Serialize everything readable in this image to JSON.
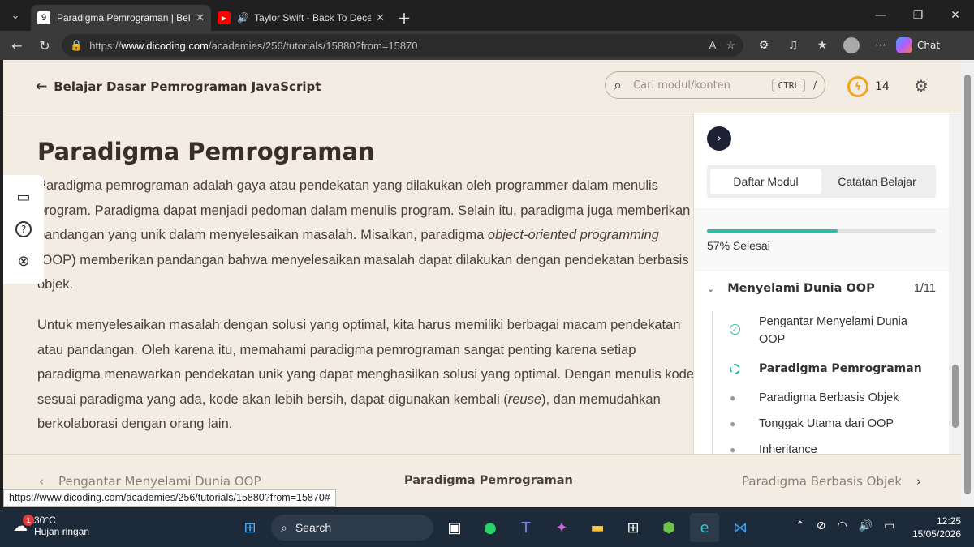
{
  "browser": {
    "tabs": [
      {
        "favicon": "9",
        "title": "Paradigma Pemrograman | Belajar",
        "active": true
      },
      {
        "favicon": "▶",
        "title": "Taylor Swift - Back To Decemb",
        "active": false
      }
    ],
    "url_prefix": "https://",
    "url_host": "www.dicoding.com",
    "url_path": "/academies/256/tutorials/15880?from=15870",
    "chat_label": "Chat"
  },
  "header": {
    "back_label": "Belajar Dasar Pemrograman JavaScript",
    "search_placeholder": "Cari modul/konten",
    "kbd_ctrl": "CTRL",
    "kbd_slash": "/",
    "points": "14"
  },
  "article": {
    "title": "Paradigma Pemrograman",
    "p1_a": "Paradigma pemrograman adalah gaya atau pendekatan yang dilakukan oleh programmer dalam menulis program. Paradigma dapat menjadi pedoman dalam menulis program. Selain itu, paradigma juga memberikan pandangan yang unik dalam menyelesaikan masalah. Misalkan, paradigma ",
    "p1_em": "object-oriented programming",
    "p1_b": " (OOP) memberikan pandangan bahwa menyelesaikan masalah dapat dilakukan dengan pendekatan berbasis objek.",
    "p2_a": "Untuk menyelesaikan masalah dengan solusi yang optimal, kita harus memiliki berbagai macam pendekatan atau pandangan. Oleh karena itu, memahami paradigma pemrograman sangat penting karena setiap paradigma menawarkan pendekatan unik yang dapat menghasilkan solusi yang optimal. Dengan menulis kode sesuai paradigma yang ada, kode akan lebih bersih, dapat digunakan kembali (",
    "p2_em": "reuse",
    "p2_b": "), dan memudahkan berkolaborasi dengan orang lain."
  },
  "sidebar": {
    "tabs": [
      "Daftar Modul",
      "Catatan Belajar"
    ],
    "progress_pct": 57,
    "progress_label": "57% Selesai",
    "module_title": "Menyelami Dunia OOP",
    "module_count": "1/11",
    "items": [
      {
        "label": "Pengantar Menyelami Dunia OOP",
        "state": "done"
      },
      {
        "label": "Paradigma Pemrograman",
        "state": "current"
      },
      {
        "label": "Paradigma Berbasis Objek",
        "state": "todo"
      },
      {
        "label": "Tonggak Utama dari OOP",
        "state": "todo"
      },
      {
        "label": "Inheritance",
        "state": "todo"
      }
    ]
  },
  "footer_nav": {
    "prev": "Pengantar Menyelami Dunia OOP",
    "current": "Paradigma Pemrograman",
    "next": "Paradigma Berbasis Objek"
  },
  "status_url": "https://www.dicoding.com/academies/256/tutorials/15880?from=15870#",
  "taskbar": {
    "weather_temp": "30°C",
    "weather_desc": "Hujan ringan",
    "weather_badge": "1",
    "search_label": "Search",
    "time": "12:25",
    "date": "15/05/2026"
  },
  "colors": {
    "accent": "#2fbfa0",
    "points": "#f4a31a",
    "background": "#f3ece3"
  }
}
